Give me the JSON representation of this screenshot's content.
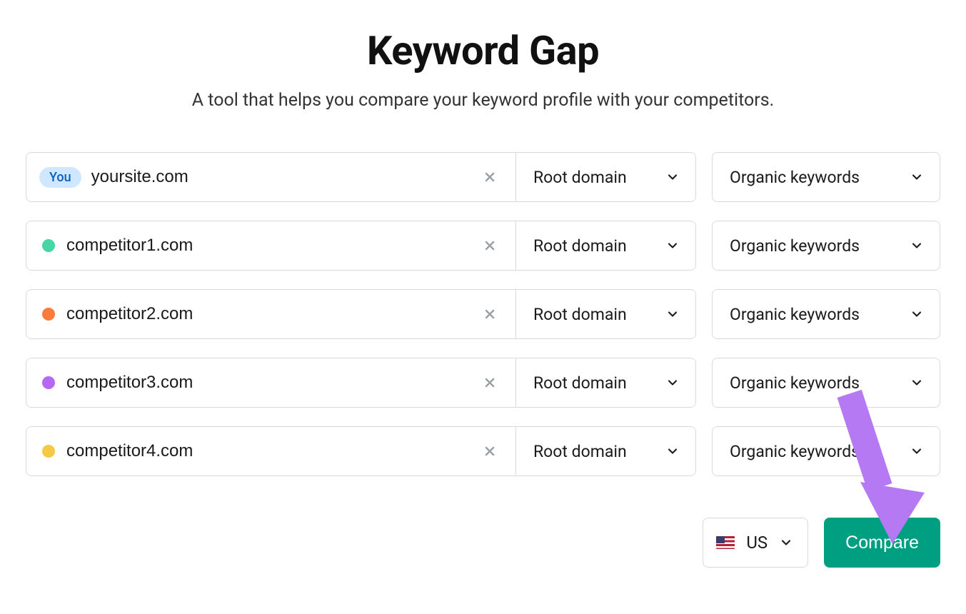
{
  "header": {
    "title": "Keyword Gap",
    "subtitle": "A tool that helps you compare your keyword profile with your competitors."
  },
  "badge_you": "You",
  "scope_label": "Root domain",
  "keyword_type_label": "Organic keywords",
  "rows": [
    {
      "kind": "you",
      "value": "yoursite.com",
      "dot": null
    },
    {
      "kind": "comp",
      "value": "competitor1.com",
      "dot": "#45d6a4"
    },
    {
      "kind": "comp",
      "value": "competitor2.com",
      "dot": "#f97c3c"
    },
    {
      "kind": "comp",
      "value": "competitor3.com",
      "dot": "#b668f2"
    },
    {
      "kind": "comp",
      "value": "competitor4.com",
      "dot": "#f6c945"
    }
  ],
  "footer": {
    "country_label": "US",
    "compare_label": "Compare"
  },
  "annotation": {
    "arrow_color": "#b679f4"
  }
}
